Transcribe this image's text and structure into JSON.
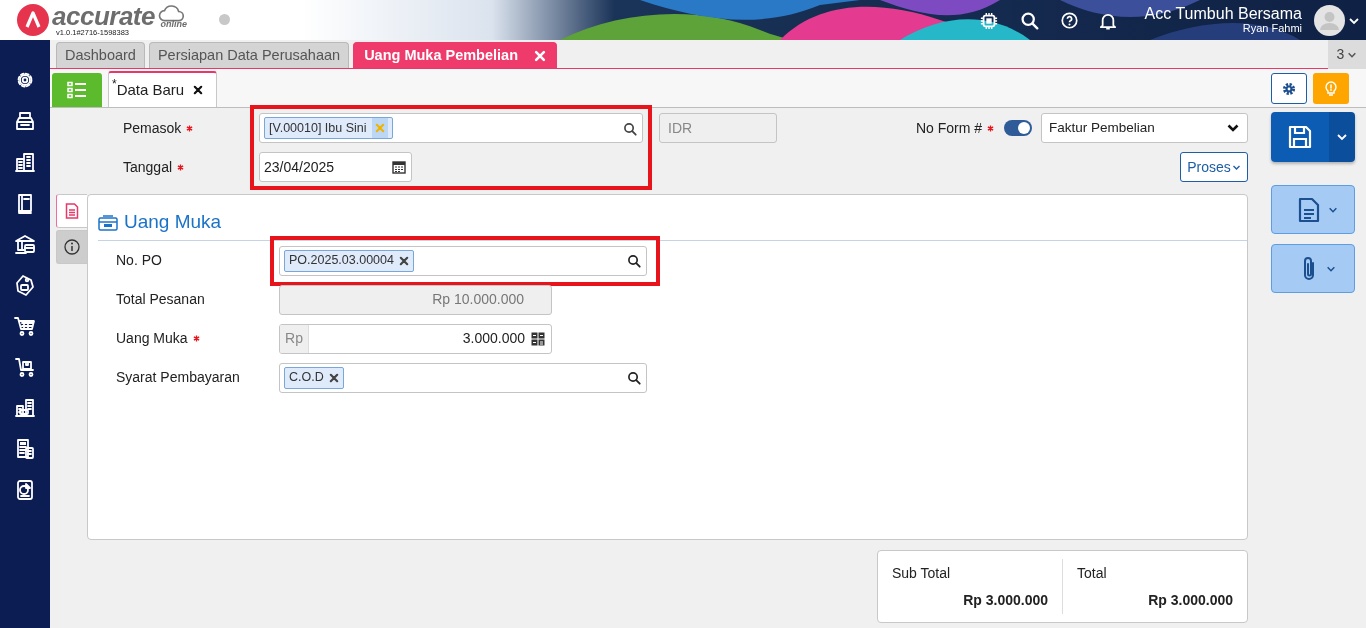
{
  "app": {
    "logo_text": "accurate",
    "logo_sub": "online",
    "version": "v1.0.1#2716-1598383"
  },
  "header": {
    "company": "Acc Tumbuh Bersama",
    "user": "Ryan Fahmi"
  },
  "tabs": [
    {
      "label": "Dashboard",
      "selected": false,
      "closable": false
    },
    {
      "label": "Persiapan Data Perusahaan",
      "selected": false,
      "closable": false
    },
    {
      "label": "Uang Muka Pembelian",
      "selected": true,
      "closable": true
    }
  ],
  "tab_count": "3",
  "subtabs": [
    {
      "label": "$^{*}$Data Baru",
      "selected": true,
      "closable": true
    }
  ],
  "form": {
    "highlighted": true,
    "supplier": {
      "label": "Pemasok",
      "required": true,
      "tags": [
        {
          "text": "[V.00010] Ibu Sini",
          "hovered": true
        }
      ]
    },
    "date": {
      "label": "Tanggal",
      "required": true,
      "value": "23/04/2025"
    },
    "currency": {
      "value": "IDR"
    },
    "form_no": {
      "label": "No Form #",
      "required": true,
      "on": true,
      "value": "Faktur Pembelian"
    },
    "process_button": "Proses"
  },
  "panel": {
    "title": "Uang Muka",
    "side_tabs": [
      {
        "kind": "document",
        "selected": true
      },
      {
        "kind": "info",
        "selected": false
      }
    ],
    "fields": [
      {
        "kind": "tags",
        "label": "No. PO",
        "required": false,
        "highlighted": true,
        "tags": [
          {
            "text": "PO.2025.03.00004",
            "hovered": false
          }
        ]
      },
      {
        "kind": "readonly",
        "label": "Total Pesanan",
        "required": false,
        "highlighted": false,
        "value": "Rp 10.000.000"
      },
      {
        "kind": "money",
        "label": "Uang Muka",
        "required": true,
        "highlighted": false,
        "prefix": "Rp",
        "value": "3.000.000"
      },
      {
        "kind": "tags",
        "label": "Syarat Pembayaran",
        "required": false,
        "highlighted": false,
        "tags": [
          {
            "text": "C.O.D",
            "hovered": false
          }
        ]
      }
    ]
  },
  "totals": [
    {
      "label": "Sub Total",
      "value": "Rp 3.000.000"
    },
    {
      "label": "Total",
      "value": "Rp 3.000.000"
    }
  ]
}
